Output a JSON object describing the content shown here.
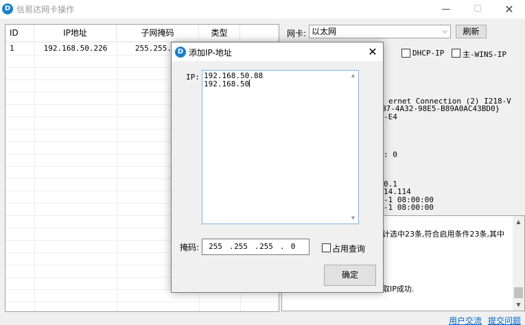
{
  "window": {
    "title": "信易达网卡操作",
    "min_glyph": "—",
    "max_glyph": "☐",
    "close_glyph": "✕",
    "icon": "app-logo-icon",
    "icon_glyph": "D"
  },
  "table": {
    "columns": [
      "ID",
      "IP地址",
      "子网掩码",
      "类型",
      ""
    ],
    "rows": [
      {
        "id": "1",
        "ip": "192.168.50.226",
        "mask": "255.255.25",
        "type": ""
      }
    ]
  },
  "nic": {
    "label": "网卡:",
    "selected": "以太网",
    "refresh_label": "刷新",
    "chevron_glyph": "⌵"
  },
  "options": {
    "dhcp_label": "DHCP-IP",
    "wins_label": "主-WINS-IP"
  },
  "info_lines": [
    "ernet Connection (2) I218-V",
    "B7-4A32-98E5-B89A0AC43BD0}",
    "-E4",
    ": 0",
    "0.1",
    "14.114",
    "-1 08:00:00",
    "-1 08:00:00"
  ],
  "log": {
    "line1": "计选中23条,符合启用条件23条,其中",
    "line2": "取IP成功."
  },
  "links": {
    "user_exchange": "用户交流",
    "report_issue": "提交问题"
  },
  "dialog": {
    "title": "添加IP-地址",
    "close_glyph": "✕",
    "ip_label": "IP:",
    "ip_lines": [
      "192.168.50.88",
      "192.168.50"
    ],
    "mask_label": "掩码:",
    "mask_octets": [
      "255",
      "255",
      "255",
      "0"
    ],
    "occupancy_label": "占用查询",
    "confirm_label": "确定",
    "scroll_up_glyph": "▲",
    "scroll_down_glyph": "▼"
  },
  "scroll_glyphs": {
    "up": "▲",
    "down": "▼"
  },
  "colors": {
    "accent": "#1a7fd0",
    "link": "#0066cc",
    "focus_border": "#7fb3e8"
  }
}
